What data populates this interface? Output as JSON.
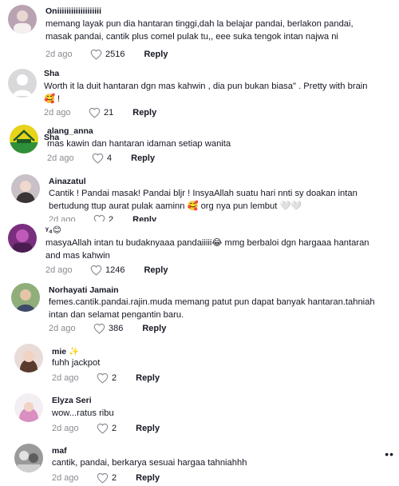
{
  "reply_label": "Reply",
  "comments": [
    {
      "username": "Oniiiiiiiiiiiiiiiiiii",
      "text": "memang layak pun dia hantaran tinggi,dah la belajar pandai, berlakon pandai, masak pandai, cantik plus comel pulak tu,, eee suka tengok intan najwa ni",
      "date": "2d ago",
      "likes": "2516"
    },
    {
      "username": "Sha",
      "text": "Worth it la duit hantaran dgn mas kahwin , dia pun bukan biasa\" . Pretty with brain 🥰 !",
      "date": "2d ago",
      "likes": "21"
    },
    {
      "username": "alang_anna",
      "text": "mas kawin dan hantaran idaman setiap wanita",
      "date": "2d ago",
      "likes": "4"
    },
    {
      "username": "Ainazatul",
      "text": "Cantik ! Pandai masak! Pandai bljr ! InsyaAllah suatu hari nnti sy doakan intan bertudung ttup aurat pulak aaminn 🥰 org nya pun lembut 🤍🤍",
      "date": "2d ago",
      "likes": "2"
    },
    {
      "username": "ᵞ₄😊",
      "text": "masyaAllah intan tu budaknyaaa pandaiiiii😂 mmg berbaloi dgn hargaaa hantaran and mas kahwin",
      "date": "2d ago",
      "likes": "1246"
    },
    {
      "username": "Norhayati Jamain",
      "text": "femes.cantik.pandai.rajin.muda memang patut pun dapat banyak hantaran.tahniah intan dan selamat pengantin baru.",
      "date": "2d ago",
      "likes": "386"
    },
    {
      "username": "mie ✨",
      "text": "fuhh jackpot",
      "date": "2d ago",
      "likes": "2"
    },
    {
      "username": "Elyza Seri",
      "text": "wow...ratus ribu",
      "date": "2d ago",
      "likes": "2"
    },
    {
      "username": "maf",
      "text": "cantik, pandai, berkarya sesuai hargaa tahniahhh",
      "date": "2d ago",
      "likes": "2"
    }
  ],
  "colors": {
    "text": "#161823",
    "muted": "#8a8b91",
    "background": "#ffffff"
  },
  "icons": {
    "like": "heart-outline-icon",
    "more": "more-dots-icon"
  }
}
